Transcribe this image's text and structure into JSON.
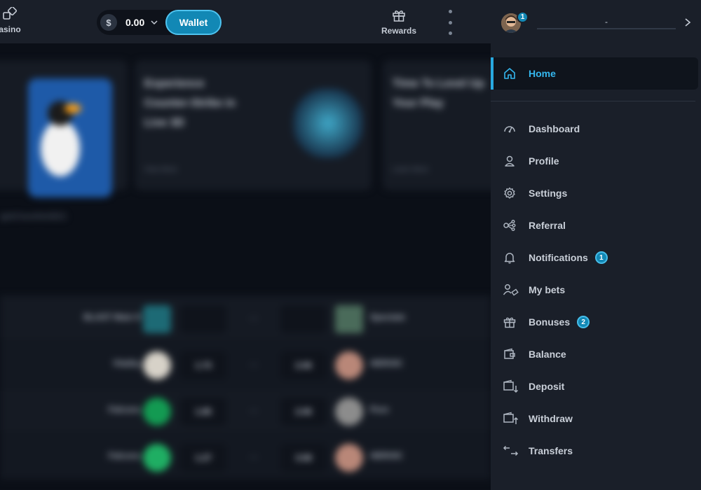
{
  "topbar": {
    "casino_label": "asino",
    "balance_currency_symbol": "$",
    "balance_amount": "0.00",
    "wallet_label": "Wallet",
    "rewards_label": "Rewards"
  },
  "background": {
    "promo_cards": [
      {
        "title": "",
        "more": ""
      },
      {
        "title": "Experience Counter-Strike in Live 3D",
        "more": "View More"
      },
      {
        "title": "Time To Level Up Your Play",
        "more": "Learn More"
      }
    ],
    "subtitle": "ightCheckNo5821",
    "matches": [
      {
        "team1": "BLAST Main 9",
        "odd1": "",
        "odd2": "",
        "team2": "Spectate"
      },
      {
        "team1": "Vitality",
        "odd1": "1.73",
        "odd2": "2.06",
        "team2": "HEROIC"
      },
      {
        "team1": "Falcons",
        "odd1": "1.85",
        "odd2": "2.06",
        "team2": "Pure"
      },
      {
        "team1": "Falcons",
        "odd1": "1.27",
        "odd2": "3.58",
        "team2": "HEROIC"
      }
    ]
  },
  "drawer": {
    "avatar_badge": "1",
    "username": "-",
    "home_label": "Home",
    "items": [
      {
        "label": "Dashboard",
        "icon": "dashboard-icon",
        "badge": ""
      },
      {
        "label": "Profile",
        "icon": "user-icon",
        "badge": ""
      },
      {
        "label": "Settings",
        "icon": "gear-icon",
        "badge": ""
      },
      {
        "label": "Referral",
        "icon": "share-icon",
        "badge": ""
      },
      {
        "label": "Notifications",
        "icon": "bell-icon",
        "badge": "1"
      },
      {
        "label": "My bets",
        "icon": "user-ticket-icon",
        "badge": ""
      },
      {
        "label": "Bonuses",
        "icon": "gift-icon",
        "badge": "2"
      },
      {
        "label": "Balance",
        "icon": "wallet-icon",
        "badge": ""
      },
      {
        "label": "Deposit",
        "icon": "deposit-icon",
        "badge": ""
      },
      {
        "label": "Withdraw",
        "icon": "withdraw-icon",
        "badge": ""
      },
      {
        "label": "Transfers",
        "icon": "transfer-icon",
        "badge": ""
      }
    ]
  },
  "colors": {
    "accent": "#28a9e0",
    "wallet_button": "#1288b5",
    "drawer_bg": "#1a1f29",
    "page_bg": "#0b0f17"
  }
}
